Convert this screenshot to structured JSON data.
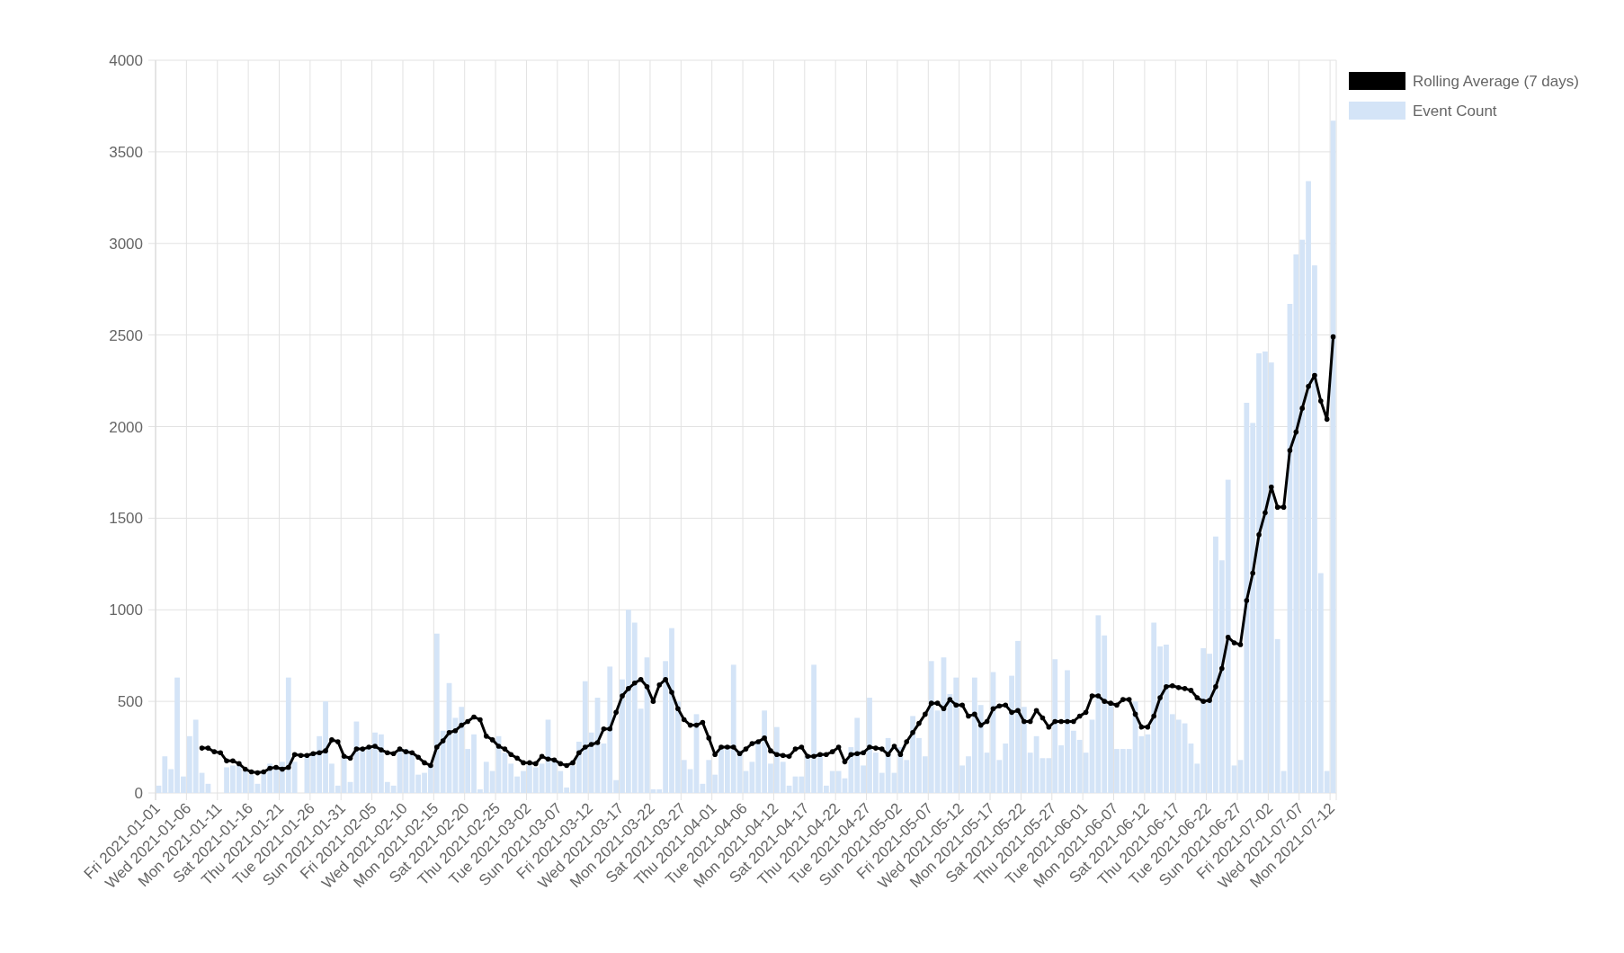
{
  "chart_data": {
    "type": "bar",
    "grid": true,
    "legend": "right",
    "ylim": [
      0,
      4000
    ],
    "yticks": [
      0,
      500,
      1000,
      1500,
      2000,
      2500,
      3000,
      3500,
      4000
    ],
    "categories": [
      "Fri 2021-01-01",
      null,
      null,
      null,
      null,
      "Wed 2021-01-06",
      null,
      null,
      null,
      null,
      "Mon 2021-01-11",
      null,
      null,
      null,
      null,
      "Sat 2021-01-16",
      null,
      null,
      null,
      null,
      "Thu 2021-01-21",
      null,
      null,
      null,
      null,
      "Tue 2021-01-26",
      null,
      null,
      null,
      null,
      "Sun 2021-01-31",
      null,
      null,
      null,
      null,
      "Fri 2021-02-05",
      null,
      null,
      null,
      null,
      "Wed 2021-02-10",
      null,
      null,
      null,
      null,
      "Mon 2021-02-15",
      null,
      null,
      null,
      null,
      "Sat 2021-02-20",
      null,
      null,
      null,
      null,
      "Thu 2021-02-25",
      null,
      null,
      null,
      null,
      "Tue 2021-03-02",
      null,
      null,
      null,
      null,
      "Sun 2021-03-07",
      null,
      null,
      null,
      null,
      "Fri 2021-03-12",
      null,
      null,
      null,
      null,
      "Wed 2021-03-17",
      null,
      null,
      null,
      null,
      "Mon 2021-03-22",
      null,
      null,
      null,
      null,
      "Sat 2021-03-27",
      null,
      null,
      null,
      null,
      "Thu 2021-04-01",
      null,
      null,
      null,
      null,
      "Tue 2021-04-06",
      null,
      null,
      null,
      null,
      "Mon 2021-04-12",
      null,
      null,
      null,
      null,
      "Sat 2021-04-17",
      null,
      null,
      null,
      null,
      "Thu 2021-04-22",
      null,
      null,
      null,
      null,
      "Tue 2021-04-27",
      null,
      null,
      null,
      null,
      "Sun 2021-05-02",
      null,
      null,
      null,
      null,
      "Fri 2021-05-07",
      null,
      null,
      null,
      null,
      "Wed 2021-05-12",
      null,
      null,
      null,
      null,
      "Mon 2021-05-17",
      null,
      null,
      null,
      null,
      "Sat 2021-05-22",
      null,
      null,
      null,
      null,
      "Thu 2021-05-27",
      null,
      null,
      null,
      null,
      "Tue 2021-06-01",
      null,
      null,
      null,
      null,
      "Mon 2021-06-07",
      null,
      null,
      null,
      null,
      "Sat 2021-06-12",
      null,
      null,
      null,
      null,
      "Thu 2021-06-17",
      null,
      null,
      null,
      null,
      "Tue 2021-06-22",
      null,
      null,
      null,
      null,
      "Sun 2021-06-27",
      null,
      null,
      null,
      null,
      "Fri 2021-07-02",
      null,
      null,
      null,
      null,
      "Wed 2021-07-07",
      null,
      null,
      null,
      null,
      "Mon 2021-07-12"
    ],
    "series": [
      {
        "name": "Rolling Average (7 days)",
        "type": "line",
        "color": "#000000",
        "values": [
          null,
          null,
          null,
          null,
          null,
          null,
          null,
          245,
          245,
          225,
          220,
          175,
          175,
          160,
          130,
          115,
          110,
          115,
          135,
          140,
          130,
          140,
          210,
          205,
          205,
          215,
          220,
          230,
          290,
          280,
          200,
          190,
          240,
          240,
          250,
          255,
          235,
          220,
          215,
          240,
          225,
          220,
          195,
          165,
          150,
          250,
          285,
          330,
          340,
          370,
          390,
          415,
          400,
          310,
          290,
          255,
          240,
          210,
          190,
          165,
          165,
          160,
          200,
          185,
          180,
          160,
          150,
          165,
          220,
          250,
          265,
          275,
          350,
          350,
          440,
          530,
          570,
          600,
          620,
          580,
          500,
          590,
          620,
          550,
          460,
          400,
          370,
          370,
          385,
          300,
          210,
          250,
          250,
          250,
          215,
          240,
          270,
          280,
          300,
          230,
          210,
          205,
          200,
          240,
          250,
          200,
          200,
          210,
          210,
          225,
          250,
          170,
          210,
          215,
          220,
          250,
          245,
          240,
          210,
          255,
          210,
          280,
          330,
          380,
          430,
          490,
          490,
          460,
          510,
          480,
          480,
          420,
          430,
          370,
          390,
          460,
          475,
          480,
          440,
          450,
          390,
          390,
          450,
          410,
          360,
          390,
          390,
          390,
          390,
          420,
          440,
          530,
          530,
          500,
          490,
          480,
          510,
          510,
          430,
          360,
          360,
          420,
          520,
          580,
          585,
          575,
          570,
          560,
          520,
          500,
          505,
          580,
          680,
          850,
          820,
          810,
          1050,
          1200,
          1410,
          1530,
          1670,
          1560,
          1560,
          1870,
          1970,
          2100,
          2220,
          2280,
          2140,
          2040,
          2490
        ]
      },
      {
        "name": "Event Count",
        "type": "bar",
        "color": "#d4e4f7",
        "values": [
          40,
          200,
          130,
          630,
          90,
          310,
          400,
          110,
          50,
          0,
          0,
          140,
          150,
          170,
          120,
          100,
          50,
          120,
          160,
          130,
          170,
          630,
          170,
          0,
          200,
          210,
          310,
          500,
          160,
          40,
          190,
          60,
          390,
          240,
          250,
          330,
          320,
          60,
          40,
          230,
          240,
          220,
          100,
          110,
          150,
          870,
          340,
          600,
          410,
          470,
          240,
          320,
          20,
          170,
          120,
          310,
          220,
          160,
          90,
          120,
          150,
          140,
          160,
          400,
          180,
          120,
          30,
          150,
          280,
          610,
          330,
          520,
          270,
          690,
          70,
          620,
          1000,
          930,
          460,
          740,
          20,
          20,
          720,
          900,
          500,
          180,
          130,
          430,
          50,
          180,
          100,
          250,
          260,
          700,
          230,
          120,
          170,
          270,
          450,
          160,
          360,
          170,
          40,
          90,
          90,
          200,
          700,
          220,
          40,
          120,
          120,
          80,
          250,
          410,
          150,
          520,
          220,
          110,
          300,
          110,
          250,
          180,
          420,
          300,
          200,
          720,
          450,
          740,
          540,
          630,
          150,
          200,
          630,
          480,
          220,
          660,
          180,
          270,
          640,
          830,
          470,
          220,
          310,
          190,
          190,
          730,
          260,
          670,
          340,
          290,
          220,
          400,
          970,
          860,
          500,
          240,
          240,
          240,
          500,
          310,
          320,
          930,
          800,
          810,
          430,
          400,
          380,
          270,
          160,
          790,
          760,
          1400,
          1270,
          1710,
          150,
          180,
          2130,
          2020,
          2400,
          2410,
          2350,
          840,
          120,
          2670,
          2940,
          3020,
          3340,
          2880,
          1200,
          120,
          3670
        ]
      }
    ]
  }
}
